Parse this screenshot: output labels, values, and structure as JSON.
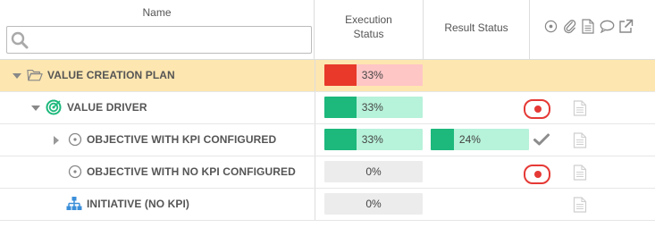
{
  "header": {
    "name_label": "Name",
    "execution_label_line1": "Execution",
    "execution_label_line2": "Status",
    "result_label": "Result Status",
    "search": {
      "value": "",
      "placeholder": ""
    },
    "icons": [
      "target-icon",
      "paperclip-icon",
      "document-icon",
      "comment-icon",
      "external-link-icon"
    ]
  },
  "rows": [
    {
      "label": "VALUE CREATION PLAN",
      "icon": "folder-open-icon",
      "expanded": true,
      "execution": {
        "value": 33,
        "text": "33%",
        "color": "#e8392a",
        "track": "#ffc6c6"
      }
    },
    {
      "label": "VALUE DRIVER",
      "icon": "bullseye-icon",
      "expanded": true,
      "execution": {
        "value": 33,
        "text": "33%",
        "color": "#1db87c",
        "track": "#b7f2da"
      },
      "status": "red-dot"
    },
    {
      "label": "OBJECTIVE WITH KPI CONFIGURED",
      "icon": "target-icon",
      "expanded": false,
      "execution": {
        "value": 33,
        "text": "33%",
        "color": "#1db87c",
        "track": "#b7f2da"
      },
      "result": {
        "value": 24,
        "text": "24%",
        "color": "#1db87c",
        "track": "#b7f2da"
      },
      "status": "check"
    },
    {
      "label": "OBJECTIVE WITH NO KPI CONFIGURED",
      "icon": "target-icon",
      "execution": {
        "value": 0,
        "text": "0%",
        "track": "#ececec"
      },
      "status": "red-dot"
    },
    {
      "label": "INITIATIVE (NO KPI)",
      "icon": "hierarchy-icon",
      "execution": {
        "value": 0,
        "text": "0%",
        "track": "#ececec"
      }
    }
  ],
  "colors": {
    "accent_red": "#e53935",
    "green": "#1db87c",
    "highlight_row": "#fde6b0",
    "tree_icon_green": "#1db87c",
    "tree_icon_blue": "#3b8fd9"
  }
}
